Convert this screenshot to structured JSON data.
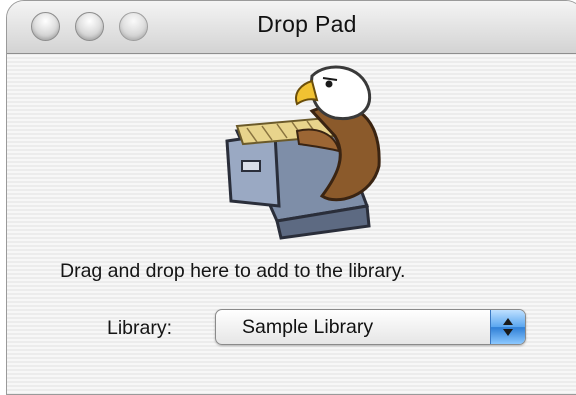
{
  "window": {
    "title": "Drop Pad",
    "buttons": [
      "close",
      "minimize",
      "zoom"
    ]
  },
  "content": {
    "illustration": "eagle-file-cabinet-icon",
    "message": "Drag and drop here to add to the library.",
    "library_label": "Library:",
    "library_selected": "Sample Library"
  },
  "colors": {
    "accent": "#5aa6f0",
    "window_bg": "#ececec"
  }
}
